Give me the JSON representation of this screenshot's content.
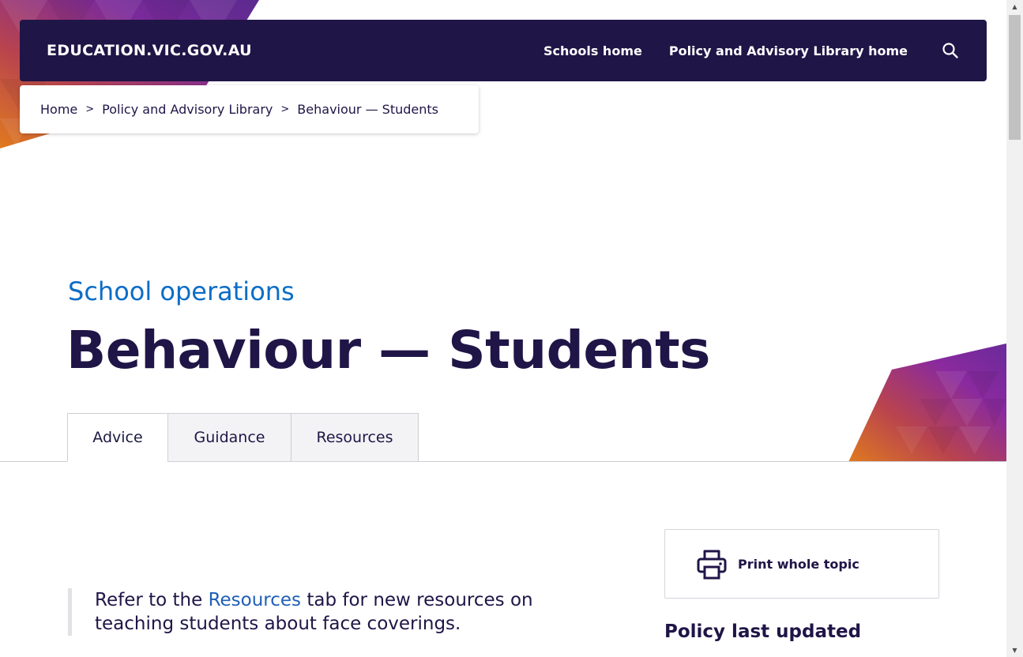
{
  "header": {
    "logo_text": "EDUCATION.VIC.GOV.AU",
    "nav": [
      {
        "label": "Schools home"
      },
      {
        "label": "Policy and Advisory Library home"
      }
    ],
    "search_icon": "search-icon",
    "background_color": "#201547"
  },
  "breadcrumb": {
    "items": [
      {
        "label": "Home"
      },
      {
        "label": "Policy and Advisory Library"
      },
      {
        "label": "Behaviour — Students"
      }
    ],
    "separator": ">"
  },
  "page": {
    "eyebrow": "School operations",
    "title": "Behaviour — Students"
  },
  "tabs": [
    {
      "label": "Advice",
      "active": true
    },
    {
      "label": "Guidance",
      "active": false
    },
    {
      "label": "Resources",
      "active": false
    }
  ],
  "callout": {
    "text_before": "Refer to the ",
    "link_text": "Resources",
    "text_after": " tab for new resources on teaching students about face coverings."
  },
  "sidebar": {
    "print_label": "Print whole topic",
    "print_icon": "printer-icon",
    "last_updated_heading": "Policy last updated"
  },
  "colors": {
    "navy": "#201547",
    "accent_blue": "#0c6dc6",
    "link_blue": "#1f5fb8"
  }
}
